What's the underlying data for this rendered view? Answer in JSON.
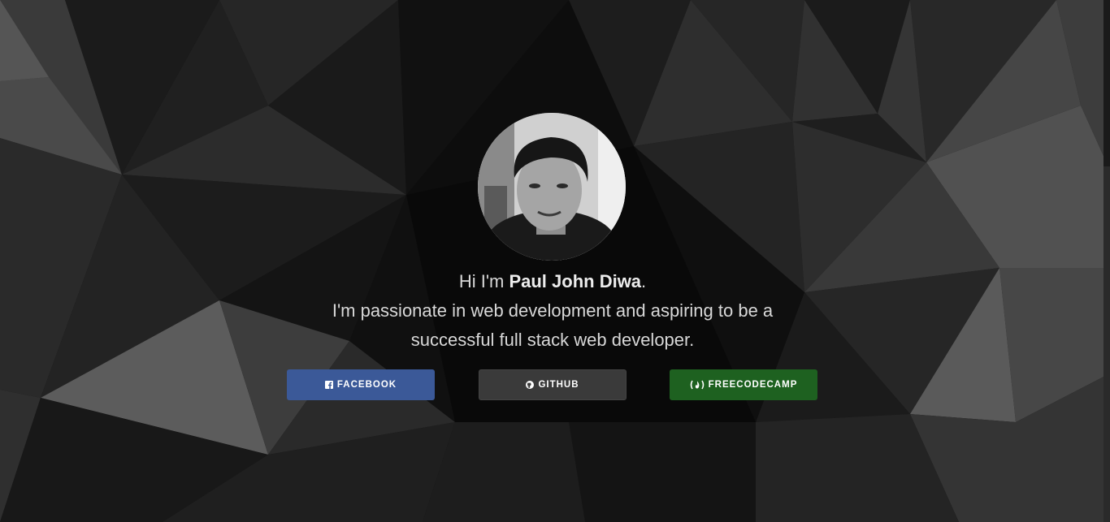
{
  "intro": {
    "greeting_prefix": "Hi I'm ",
    "name": "Paul John Diwa",
    "greeting_suffix": ".",
    "line2": "I'm passionate in web development and aspiring to be a",
    "line3": "successful full stack web developer."
  },
  "buttons": {
    "facebook": {
      "label": "FACEBOOK",
      "icon": "facebook-icon",
      "color": "#3b5998"
    },
    "github": {
      "label": "GITHUB",
      "icon": "github-icon",
      "color": "#3a3a3a"
    },
    "freecodecamp": {
      "label": "FREECODECAMP",
      "icon": "freecodecamp-icon",
      "color": "#1e6120"
    }
  },
  "theme": {
    "background": "dark low-poly",
    "text": "#d8d8d8"
  }
}
